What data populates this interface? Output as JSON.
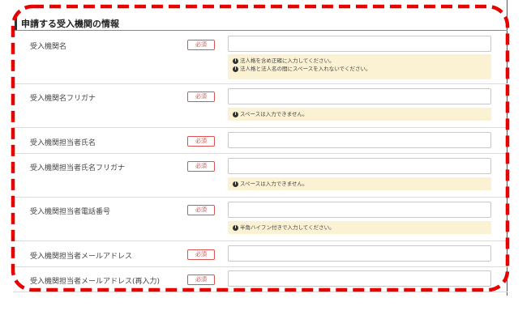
{
  "section": {
    "title": "申請する受入機関の情報"
  },
  "required_label": "必須",
  "fields": [
    {
      "label": "受入機関名",
      "value": "",
      "help": [
        "法人格を含め正確に入力してください。",
        "法人格と法人名の間にスペースを入れないでください。"
      ]
    },
    {
      "label": "受入機関名フリガナ",
      "value": "",
      "help": [
        "スペースは入力できません。"
      ]
    },
    {
      "label": "受入機関担当者氏名",
      "value": "",
      "help": []
    },
    {
      "label": "受入機関担当者氏名フリガナ",
      "value": "",
      "help": [
        "スペースは入力できません。"
      ]
    },
    {
      "label": "受入機関担当者電話番号",
      "value": "",
      "help": [
        "半角ハイフン付きで入力してください。"
      ]
    },
    {
      "label": "受入機関担当者メールアドレス",
      "value": "",
      "help": []
    },
    {
      "label": "受入機関担当者メールアドレス(再入力)",
      "value": "",
      "help": []
    }
  ],
  "icons": {
    "info": "info-circle-icon"
  },
  "colors": {
    "required": "#d9534f",
    "help_bg": "#fbf1d3",
    "highlight_dash": "#e60000"
  }
}
